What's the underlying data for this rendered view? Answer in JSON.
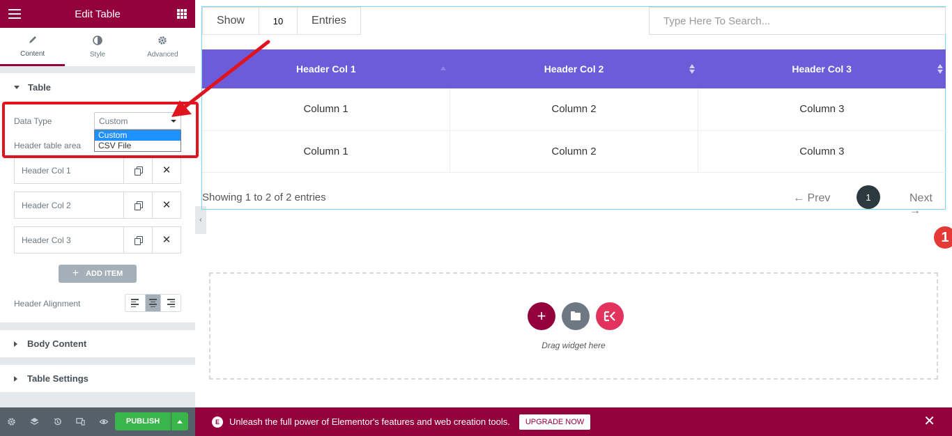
{
  "panel": {
    "title": "Edit Table",
    "tabs": [
      {
        "label": "Content",
        "icon": "pencil-icon"
      },
      {
        "label": "Style",
        "icon": "contrast-icon"
      },
      {
        "label": "Advanced",
        "icon": "gear-icon"
      }
    ],
    "section_table": "Table",
    "data_type_label": "Data Type",
    "data_type_value": "Custom",
    "data_type_options": [
      "Custom",
      "CSV File"
    ],
    "header_area_label": "Header table area",
    "header_items": [
      "Header Col 1",
      "Header Col 2",
      "Header Col 3"
    ],
    "add_item_label": "ADD ITEM",
    "header_alignment_label": "Header Alignment",
    "section_body": "Body Content",
    "section_settings": "Table Settings",
    "publish_label": "PUBLISH"
  },
  "table_widget": {
    "show_label": "Show",
    "entries_count": "10",
    "entries_label": "Entries",
    "search_placeholder": "Type Here To Search...",
    "headers": [
      "Header Col 1",
      "Header Col 2",
      "Header Col 3"
    ],
    "rows": [
      [
        "Column 1",
        "Column 2",
        "Column 3"
      ],
      [
        "Column 1",
        "Column 2",
        "Column 3"
      ]
    ],
    "header_color": "#6c5cd9",
    "showing_text": "Showing 1 to 2 of 2 entries",
    "prev_label": "← Prev",
    "current_page": "1",
    "next_label": "Next →"
  },
  "dropzone": {
    "text": "Drag widget here"
  },
  "notification_count": "1",
  "promo": {
    "message": "Unleash the full power of Elementor's features and web creation tools.",
    "upgrade_label": "UPGRADE NOW"
  },
  "colors": {
    "brand": "#93003c",
    "publish": "#39b54a",
    "annotation": "#e0141e"
  }
}
